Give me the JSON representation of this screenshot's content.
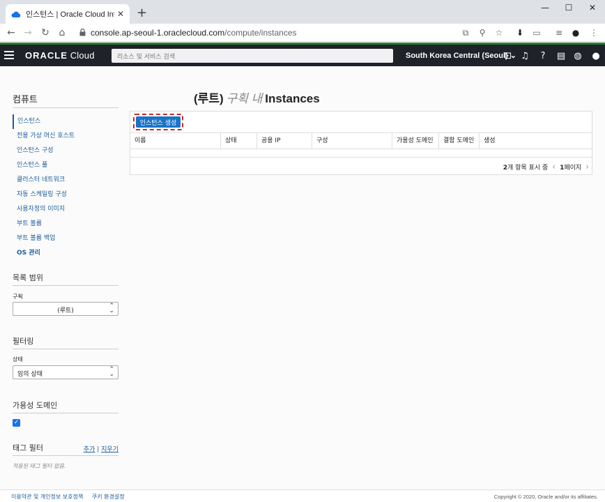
{
  "browser": {
    "tab_title": "인스턴스 | Oracle Cloud Infrastr",
    "url_host": "console.ap-seoul-1.oraclecloud.com",
    "url_path": "/compute/instances"
  },
  "header": {
    "logo_brand": "ORACLE",
    "logo_product": "Cloud",
    "search_placeholder": "리소스 및 서비스 검색",
    "region": "South Korea Central (Seoul)"
  },
  "sidebar": {
    "title": "컴퓨트",
    "items": [
      {
        "label": "인스턴스",
        "active": true
      },
      {
        "label": "전용 가상 머신 호스트"
      },
      {
        "label": "인스턴스 구성"
      },
      {
        "label": "인스턴스 풀"
      },
      {
        "label": "클러스터 네트워크"
      },
      {
        "label": "자동 스케일링 구성"
      },
      {
        "label": "사용자정의 이미지"
      },
      {
        "label": "부트 볼륨"
      },
      {
        "label": "부트 볼륨 백업"
      },
      {
        "label": "OS 관리",
        "strong": true
      }
    ],
    "scope_title": "목록 범위",
    "compartment_label": "구획",
    "compartment_value": "(루트)",
    "filter_title": "필터링",
    "state_label": "상태",
    "state_value": "임의 상태",
    "ad_title": "가용성 도메인",
    "tag_title": "태그 필터",
    "tag_add": "추가",
    "tag_sep": "|",
    "tag_clear": "지우기",
    "tag_none": "적용된 태그 필터 없음."
  },
  "main": {
    "title_prefix": "(루트)",
    "title_mid": "구획 내",
    "title_main": "Instances",
    "create_button": "인스턴스 생성",
    "columns": [
      "이름",
      "상태",
      "공용 IP",
      "구성",
      "가용성 도메인",
      "결함 도메인",
      "생성"
    ],
    "pager_count": "2",
    "pager_text": "개 항목 표시 중",
    "pager_page": "1",
    "pager_page_text": "페이지"
  },
  "footer": {
    "links": [
      "이용약관 및 개인정보 보호정책",
      "쿠키 환경설정"
    ],
    "copyright": "Copyright © 2020, Oracle and/or its affiliates."
  }
}
